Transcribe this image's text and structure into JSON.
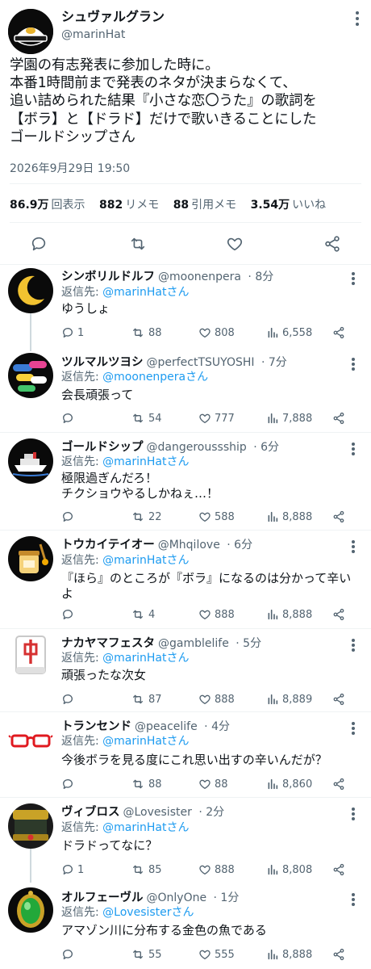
{
  "main_tweet": {
    "display_name": "シュヴァルグラン",
    "handle": "@marinHat",
    "text": "学園の有志発表に参加した時に。\n本番1時間前まで発表のネタが決まらなくて、\n追い詰められた結果『小さな恋〇うた』の歌詞を\n【ボラ】と【ドラド】だけで歌いきることにした\nゴールドシップさん",
    "timestamp": "2026年9月29日 19:50",
    "stats": {
      "views": "86.9万",
      "views_label": "回表示",
      "retweets": "882",
      "retweets_label": "リメモ",
      "quotes": "88",
      "quotes_label": "引用メモ",
      "likes": "3.54万",
      "likes_label": "いいね"
    }
  },
  "reply_prefix": "返信先: ",
  "reply_suffix": "さん",
  "replies": [
    {
      "name": "シンボリルドルフ",
      "handle": "@moonenpera",
      "time": "· 8分",
      "reply_to": "@marinHat",
      "text": "ゆうしょ",
      "replies": "1",
      "retweets": "88",
      "likes": "808",
      "views": "6,558",
      "avatar": "crescent-moon"
    },
    {
      "name": "ツルマルツヨシ",
      "handle": "@perfectTSUYOSHI",
      "time": "· 7分",
      "reply_to": "@moonenpera",
      "text": "会長頑張って",
      "replies": "",
      "retweets": "54",
      "likes": "777",
      "views": "7,888",
      "avatar": "pills"
    },
    {
      "name": "ゴールドシップ",
      "handle": "@dangeroussship",
      "time": "· 6分",
      "reply_to": "@marinHat",
      "text": "極限過ぎんだろ！\nチクショウやるしかねぇ…！",
      "replies": "",
      "retweets": "22",
      "likes": "588",
      "views": "8,888",
      "avatar": "ship"
    },
    {
      "name": "トウカイテイオー",
      "handle": "@Mhqilove",
      "time": "· 6分",
      "reply_to": "@marinHat",
      "text": "『ほら』のところが『ボラ』になるのは分かって辛い\nよ",
      "replies": "",
      "retweets": "4",
      "likes": "888",
      "views": "8,888",
      "avatar": "honey"
    },
    {
      "name": "ナカヤマフェスタ",
      "handle": "@gamblelife",
      "time": "· 5分",
      "reply_to": "@marinHat",
      "text": "頑張ったな次女",
      "replies": "",
      "retweets": "87",
      "likes": "888",
      "views": "8,889",
      "avatar": "mahjong"
    },
    {
      "name": "トランセンド",
      "handle": "@peacelife",
      "time": "· 4分",
      "reply_to": "@marinHat",
      "text": "今後ボラを見る度にこれ思い出すの辛いんだが？",
      "replies": "",
      "retweets": "88",
      "likes": "88",
      "views": "8,860",
      "avatar": "glasses"
    },
    {
      "name": "ヴィブロス",
      "handle": "@Lovesister",
      "time": "· 2分",
      "reply_to": "@marinHat",
      "text": "ドラドってなに？",
      "replies": "1",
      "retweets": "85",
      "likes": "888",
      "views": "8,808",
      "avatar": "crown"
    },
    {
      "name": "オルフェーヴル",
      "handle": "@OnlyOne",
      "time": "· 1分",
      "reply_to": "@Lovesister",
      "text": "アマゾン川に分布する金色の魚である",
      "replies": "",
      "retweets": "55",
      "likes": "555",
      "views": "8,888",
      "avatar": "emerald"
    }
  ],
  "colors": {
    "text": "#0f1419",
    "secondary": "#536471",
    "link": "#1d9bf0",
    "divider": "#eff3f4",
    "thread_line": "#cfd9de"
  }
}
